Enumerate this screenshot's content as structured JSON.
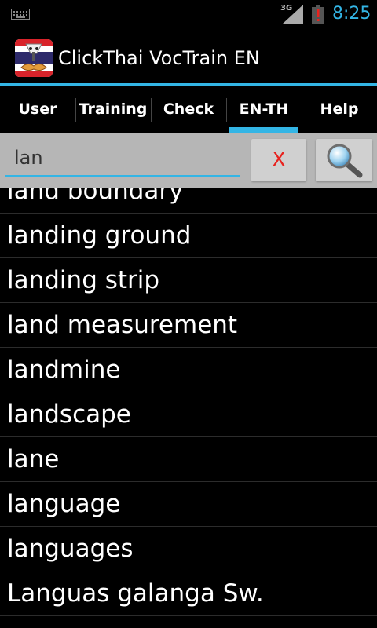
{
  "status": {
    "network": "3G",
    "time": "8:25",
    "accent": "#33b5e5",
    "battery_color": "#e8221e"
  },
  "app": {
    "title": "ClickThai VocTrain EN",
    "logo_icon": "thai-flag-face-icon"
  },
  "tabs": [
    {
      "label": "User",
      "active": false
    },
    {
      "label": "Training",
      "active": false
    },
    {
      "label": "Check",
      "active": false
    },
    {
      "label": "EN-TH",
      "active": true
    },
    {
      "label": "Help",
      "active": false
    }
  ],
  "search": {
    "value": "lan",
    "clear_label": "X",
    "search_icon": "magnifier-icon"
  },
  "results": [
    "land boundary",
    "landing ground",
    "landing strip",
    "land measurement",
    "landmine",
    "landscape",
    "lane",
    "language",
    "languages",
    "Languas galanga Sw."
  ]
}
